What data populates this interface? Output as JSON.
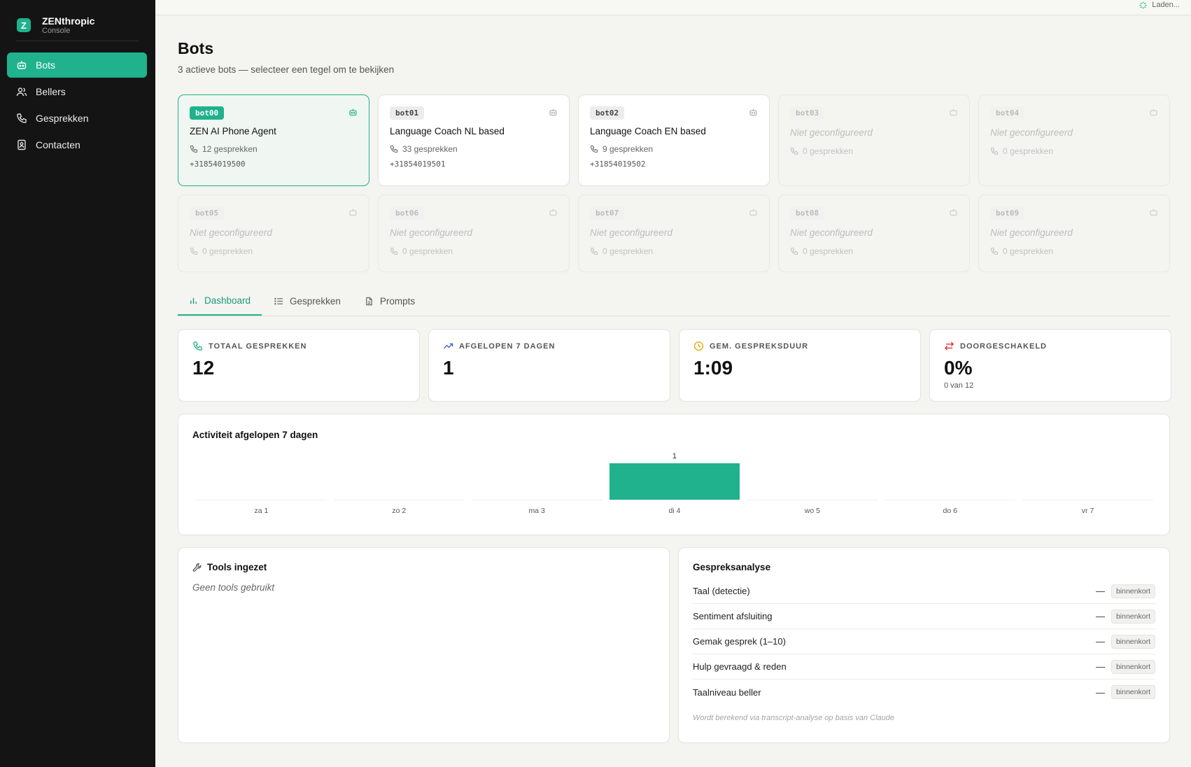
{
  "brand": {
    "logo": "Z",
    "name": "ZENthropic",
    "sub": "Console"
  },
  "nav": [
    {
      "label": "Bots",
      "icon": "bot-icon",
      "active": true
    },
    {
      "label": "Bellers",
      "icon": "users-icon",
      "active": false
    },
    {
      "label": "Gesprekken",
      "icon": "phone-icon",
      "active": false
    },
    {
      "label": "Contacten",
      "icon": "contact-book-icon",
      "active": false
    }
  ],
  "topbar": {
    "status": "Laden..."
  },
  "page": {
    "title": "Bots",
    "subtitle": "3 actieve bots — selecteer een tegel om te bekijken"
  },
  "bots": [
    {
      "id": "bot00",
      "name": "ZEN AI Phone Agent",
      "calls": "12 gesprekken",
      "phone": "+31854019500",
      "state": "active"
    },
    {
      "id": "bot01",
      "name": "Language Coach NL based",
      "calls": "33 gesprekken",
      "phone": "+31854019501",
      "state": "configured"
    },
    {
      "id": "bot02",
      "name": "Language Coach EN based",
      "calls": "9 gesprekken",
      "phone": "+31854019502",
      "state": "configured"
    },
    {
      "id": "bot03",
      "name": "Niet geconfigureerd",
      "calls": "0 gesprekken",
      "phone": "",
      "state": "empty"
    },
    {
      "id": "bot04",
      "name": "Niet geconfigureerd",
      "calls": "0 gesprekken",
      "phone": "",
      "state": "empty"
    },
    {
      "id": "bot05",
      "name": "Niet geconfigureerd",
      "calls": "0 gesprekken",
      "phone": "",
      "state": "empty"
    },
    {
      "id": "bot06",
      "name": "Niet geconfigureerd",
      "calls": "0 gesprekken",
      "phone": "",
      "state": "empty"
    },
    {
      "id": "bot07",
      "name": "Niet geconfigureerd",
      "calls": "0 gesprekken",
      "phone": "",
      "state": "empty"
    },
    {
      "id": "bot08",
      "name": "Niet geconfigureerd",
      "calls": "0 gesprekken",
      "phone": "",
      "state": "empty"
    },
    {
      "id": "bot09",
      "name": "Niet geconfigureerd",
      "calls": "0 gesprekken",
      "phone": "",
      "state": "empty"
    }
  ],
  "tabs": [
    {
      "label": "Dashboard",
      "icon": "bar-chart-icon",
      "active": true
    },
    {
      "label": "Gesprekken",
      "icon": "list-icon",
      "active": false
    },
    {
      "label": "Prompts",
      "icon": "document-icon",
      "active": false
    }
  ],
  "stats": [
    {
      "label": "TOTAAL GESPREKKEN",
      "value": "12",
      "note": "",
      "icon": "phone-icon",
      "color": "#1fb28c"
    },
    {
      "label": "AFGELOPEN 7 DAGEN",
      "value": "1",
      "note": "",
      "icon": "trending-up-icon",
      "color": "#3b5bdb"
    },
    {
      "label": "GEM. GESPREKSDUUR",
      "value": "1:09",
      "note": "",
      "icon": "clock-icon",
      "color": "#e0a800"
    },
    {
      "label": "DOORGESCHAKELD",
      "value": "0%",
      "note": "0 van 12",
      "icon": "transfer-arrows-icon",
      "color": "#e03131"
    }
  ],
  "activity": {
    "title": "Activiteit afgelopen 7 dagen"
  },
  "chart_data": {
    "type": "bar",
    "categories": [
      "za 1",
      "zo 2",
      "ma 3",
      "di 4",
      "wo 5",
      "do 6",
      "vr 7"
    ],
    "values": [
      0,
      0,
      0,
      1,
      0,
      0,
      0
    ],
    "title": "Activiteit afgelopen 7 dagen",
    "xlabel": "",
    "ylabel": "",
    "ylim": [
      0,
      1
    ],
    "data_labels": [
      "",
      "",
      "",
      "1",
      "",
      "",
      ""
    ],
    "grid": false,
    "color": "#1fb28c"
  },
  "tools": {
    "title": "Tools ingezet",
    "empty": "Geen tools gebruikt",
    "icon": "wrench-icon"
  },
  "analysis": {
    "title": "Gespreksanalyse",
    "rows": [
      {
        "label": "Taal (detectie)",
        "value": "—",
        "badge": "binnenkort"
      },
      {
        "label": "Sentiment afsluiting",
        "value": "—",
        "badge": "binnenkort"
      },
      {
        "label": "Gemak gesprek (1–10)",
        "value": "—",
        "badge": "binnenkort"
      },
      {
        "label": "Hulp gevraagd & reden",
        "value": "—",
        "badge": "binnenkort"
      },
      {
        "label": "Taalniveau beller",
        "value": "—",
        "badge": "binnenkort"
      }
    ],
    "footnote": "Wordt berekend via transcript-analyse op basis van Claude"
  },
  "colors": {
    "accent": "#1fb28c",
    "sidebar": "#141414",
    "background": "#f4f4f1"
  }
}
